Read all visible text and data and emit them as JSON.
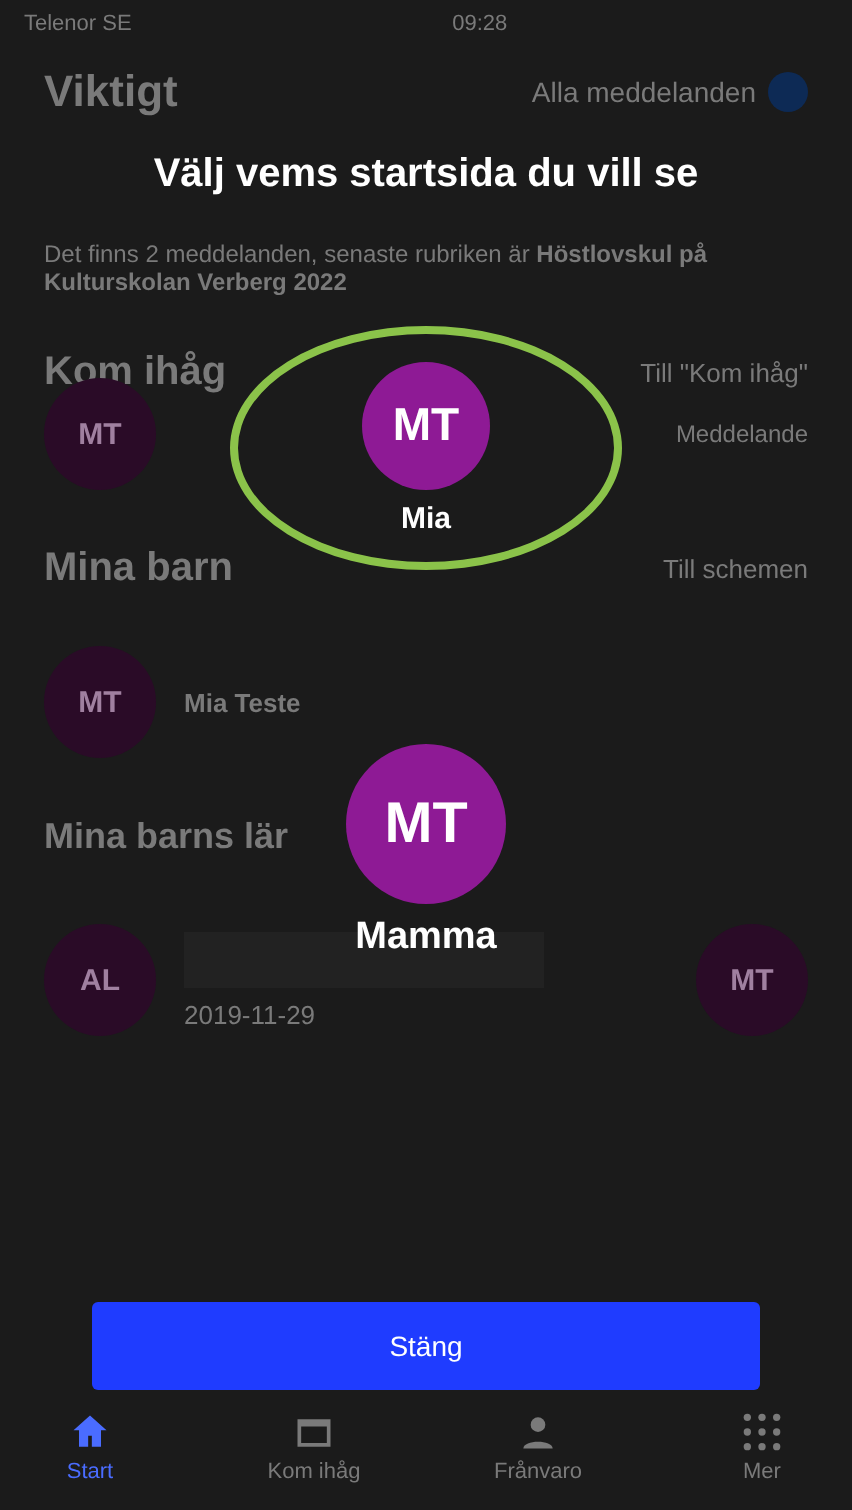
{
  "status_bar": {
    "carrier": "Telenor SE",
    "time": "09:28"
  },
  "important": {
    "title": "Viktigt",
    "link": "Alla meddelanden",
    "message": "Det finns 2 meddelanden, senaste rubriken är",
    "highlight": "Höstlovskul på Kulturskolan Verberg 2022"
  },
  "remember": {
    "title": "Kom ihåg",
    "link": "Till \"Kom ihåg\"",
    "avatar": "MT",
    "tag": "Meddelande"
  },
  "children": {
    "title": "Mina barn",
    "link": "Till schemen",
    "avatar": "MT",
    "name": "Mia Teste"
  },
  "teachers": {
    "title": "Mina barns lär",
    "avatar": "AL",
    "date": "2019-11-29",
    "avatar_right": "MT"
  },
  "tabs": [
    {
      "label": "Start",
      "selected": true
    },
    {
      "label": "Kom ihåg",
      "selected": false
    },
    {
      "label": "Frånvaro",
      "selected": false
    },
    {
      "label": "Mer",
      "selected": false
    }
  ],
  "dialog": {
    "title": "Välj vems startsida du vill se",
    "profiles": [
      {
        "initials": "MT",
        "name": "Mia",
        "selected": true
      },
      {
        "initials": "MT",
        "name": "Mamma",
        "selected": false
      }
    ],
    "close_button": "Stäng"
  }
}
